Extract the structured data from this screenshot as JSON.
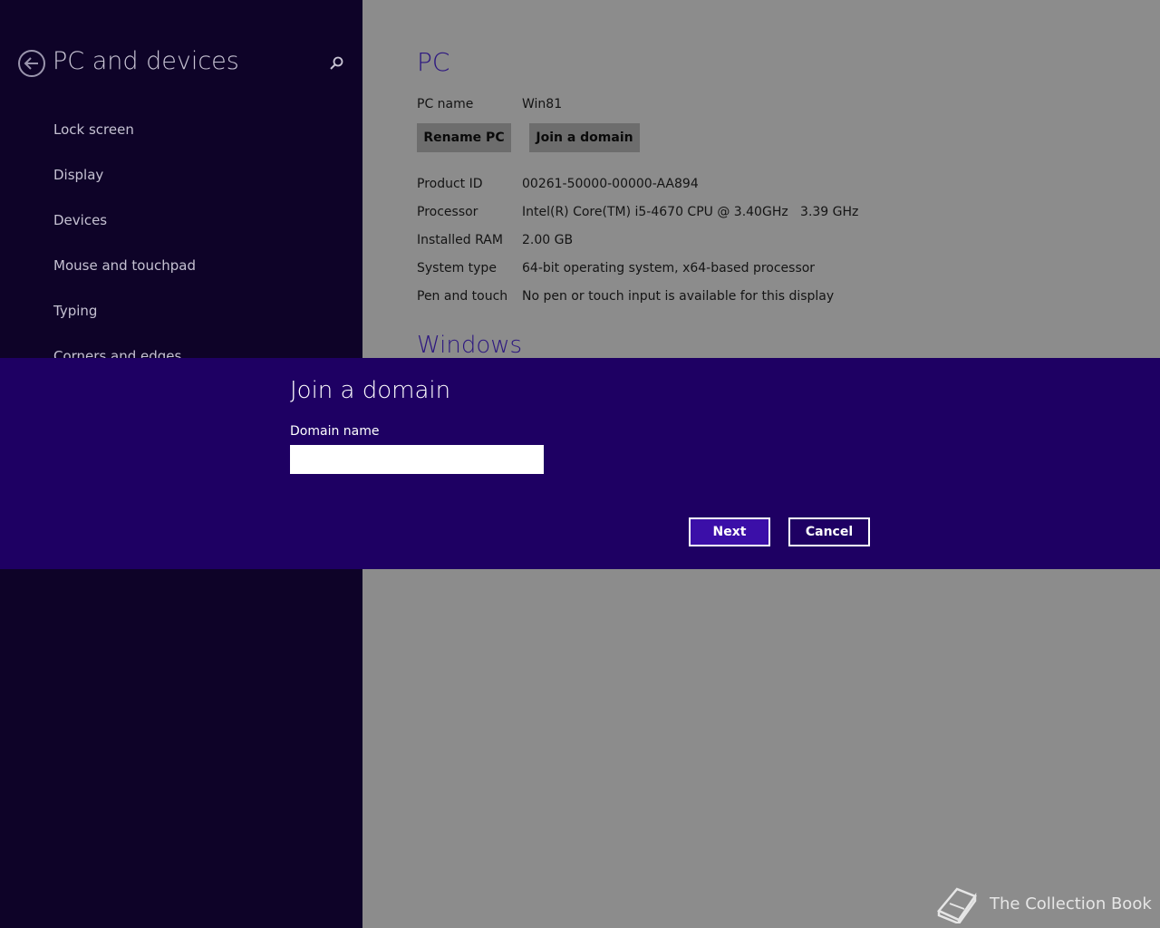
{
  "nav": {
    "title": "PC and devices",
    "items": [
      {
        "label": "Lock screen"
      },
      {
        "label": "Display"
      },
      {
        "label": "Devices"
      },
      {
        "label": "Mouse and touchpad"
      },
      {
        "label": "Typing"
      },
      {
        "label": "Corners and edges"
      }
    ]
  },
  "content": {
    "heading": "PC",
    "pc_name_label": "PC name",
    "pc_name_value": "Win81",
    "rename_label": "Rename PC",
    "join_label": "Join a domain",
    "specs": [
      {
        "key": "Product ID",
        "value": "00261-50000-00000-AA894"
      },
      {
        "key": "Processor",
        "value": "Intel(R) Core(TM) i5-4670 CPU @ 3.40GHz   3.39 GHz"
      },
      {
        "key": "Installed RAM",
        "value": "2.00 GB"
      },
      {
        "key": "System type",
        "value": "64-bit operating system, x64-based processor"
      },
      {
        "key": "Pen and touch",
        "value": "No pen or touch input is available for this display"
      }
    ],
    "section2_heading": "Windows"
  },
  "dialog": {
    "title": "Join a domain",
    "field_label": "Domain name",
    "field_value": "",
    "next_label": "Next",
    "cancel_label": "Cancel"
  },
  "watermark": {
    "text": "The Collection Book",
    "icon": "book-icon"
  },
  "colors": {
    "nav_bg": "#0e0328",
    "dialog_bg": "#1e0063",
    "accent": "#3b0fa8",
    "content_bg": "#8c8c8c"
  }
}
